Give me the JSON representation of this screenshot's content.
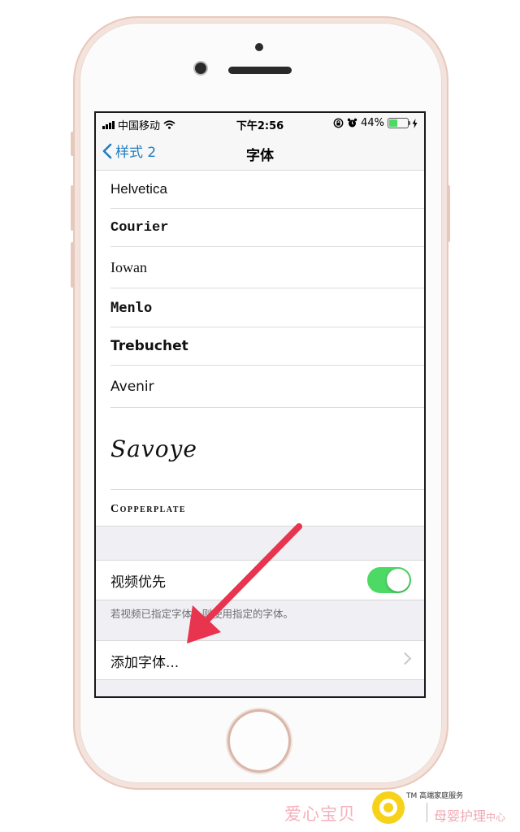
{
  "status_bar": {
    "carrier": "中国移动",
    "time": "下午2:56",
    "battery": "44%",
    "battery_level": 0.44
  },
  "nav": {
    "back_label": "样式 2",
    "title": "字体"
  },
  "fonts": [
    "Helvetica",
    "Courier",
    "Iowan",
    "Menlo",
    "Trebuchet",
    "Avenir",
    "Savoye",
    "Copperplate"
  ],
  "video_pref": {
    "label": "视频优先",
    "enabled": true,
    "footnote": "若视频已指定字体，则使用指定的字体。"
  },
  "add_font_label": "添加字体...",
  "colors": {
    "link": "#1f7dbf",
    "switch_on": "#4cd964",
    "arrow": "#e8344e"
  },
  "watermark": {
    "brand": "爱心宝贝",
    "tm_text": "TM 高端家庭服务",
    "service_main": "母婴护理",
    "service_small": "中心"
  }
}
